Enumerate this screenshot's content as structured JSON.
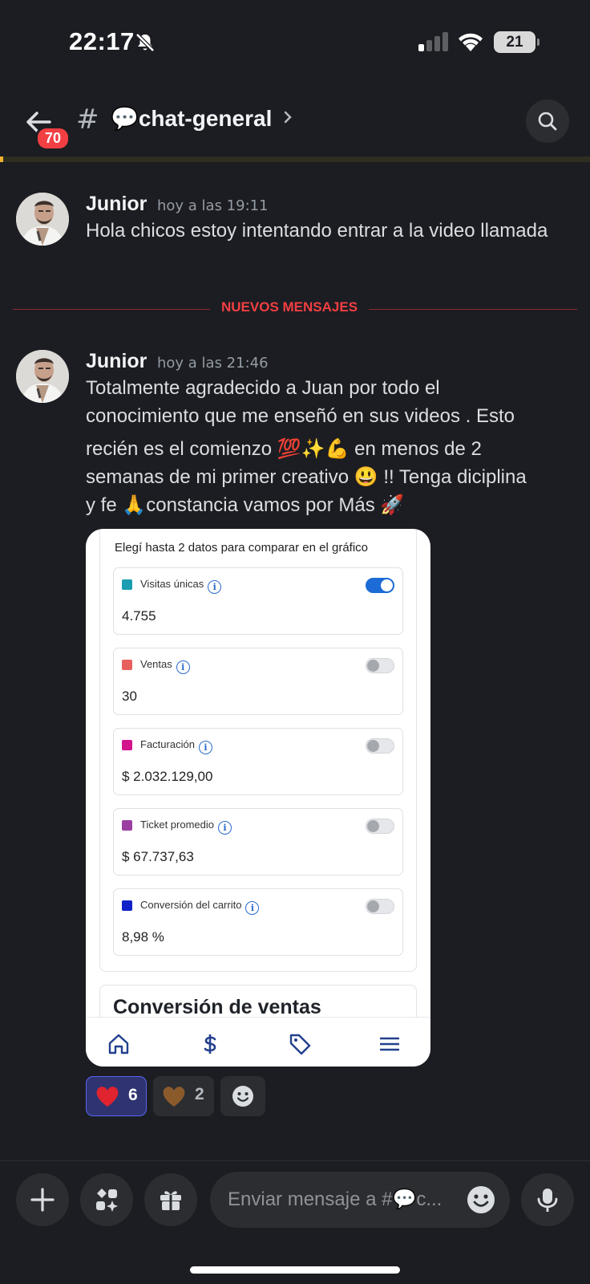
{
  "status_bar": {
    "time": "22:17",
    "battery": "21"
  },
  "header": {
    "unread_badge": "70",
    "hash_symbol": "#",
    "channel_name": "💬chat-general"
  },
  "messages": [
    {
      "author": "Junior",
      "time": "hoy a las 19:11",
      "text": "Hola chicos  estoy intentando entrar  a la video llamada"
    },
    {
      "author": "Junior",
      "time": "hoy a las 21:46",
      "text_lines": [
        "Totalmente agradecido a Juan  por todo el",
        "conocimiento  que me enseñó  en sus videos  . Esto",
        "recién es el comienzo 💯✨💪 en menos de 2",
        "semanas de mi primer creativo 😃 !!  Tenga diciplina",
        "y fe  🙏constancia   vamos por Más 🚀"
      ]
    }
  ],
  "divider": {
    "label": "NUEVOS MENSAJES"
  },
  "attachment": {
    "title": "Elegí hasta 2 datos para comparar en el gráfico",
    "metrics": [
      {
        "name": "Visitas únicas",
        "value": "4.755",
        "color": "#1a9db0",
        "enabled": true
      },
      {
        "name": "Ventas",
        "value": "30",
        "color": "#e8605e",
        "enabled": false
      },
      {
        "name": "Facturación",
        "value": "$ 2.032.129,00",
        "color": "#d4148d",
        "enabled": false
      },
      {
        "name": "Ticket promedio",
        "value": "$ 67.737,63",
        "color": "#9b3fa3",
        "enabled": false
      },
      {
        "name": "Conversión del carrito",
        "value": "8,98 %",
        "color": "#1023c9",
        "enabled": false
      }
    ],
    "section_title": "Conversión de ventas",
    "info_glyph": "i",
    "nav_icons": [
      "home-icon",
      "dollar-icon",
      "tag-icon",
      "menu-icon"
    ]
  },
  "reactions": [
    {
      "emoji": "heart-red",
      "count": "6",
      "mine": true
    },
    {
      "emoji": "heart-brown",
      "count": "2",
      "mine": false
    }
  ],
  "composer": {
    "placeholder": "Enviar mensaje a #💬c..."
  }
}
